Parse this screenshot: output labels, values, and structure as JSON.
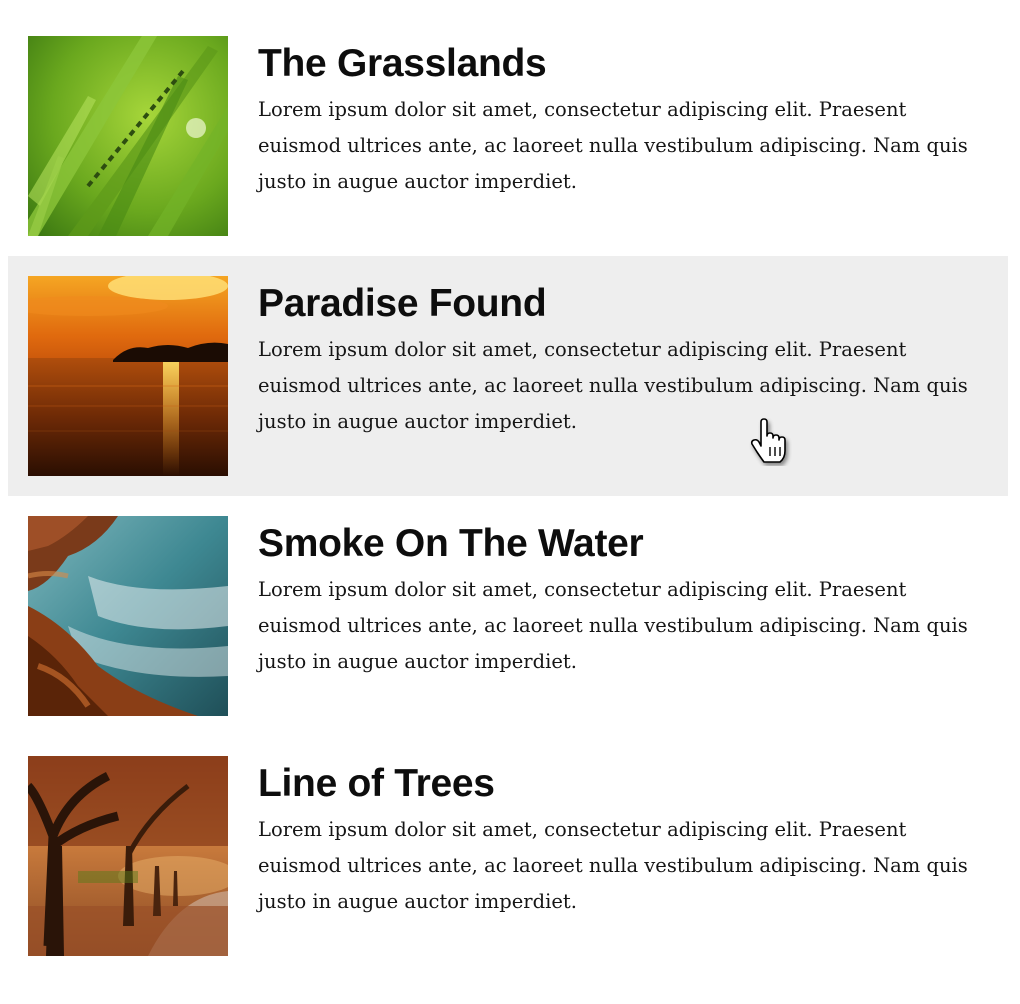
{
  "items": [
    {
      "title": "The Grasslands",
      "text": "Lorem ipsum dolor sit amet, consectetur adipiscing elit. Praesent euismod ultrices ante, ac laoreet nulla vestibulum adipiscing. Nam quis justo in augue auctor imperdiet.",
      "image": "grassland-photo"
    },
    {
      "title": "Paradise Found",
      "text": "Lorem ipsum dolor sit amet, consectetur adipiscing elit. Praesent euismod ultrices ante, ac laoreet nulla vestibulum adipiscing. Nam quis justo in augue auctor imperdiet.",
      "image": "sunset-lake-photo",
      "hovered": true
    },
    {
      "title": "Smoke On The Water",
      "text": "Lorem ipsum dolor sit amet, consectetur adipiscing elit. Praesent euismod ultrices ante, ac laoreet nulla vestibulum adipiscing. Nam quis justo in augue auctor imperdiet.",
      "image": "coast-water-photo"
    },
    {
      "title": "Line of Trees",
      "text": "Lorem ipsum dolor sit amet, consectetur adipiscing elit. Praesent euismod ultrices ante, ac laoreet nulla vestibulum adipiscing. Nam quis justo in augue auctor imperdiet.",
      "image": "autumn-trees-photo"
    }
  ],
  "colors": {
    "hover_background": "#eeeeee",
    "title": "#0d0d0d",
    "text": "#151515"
  },
  "cursor": "hand-pointer-icon"
}
